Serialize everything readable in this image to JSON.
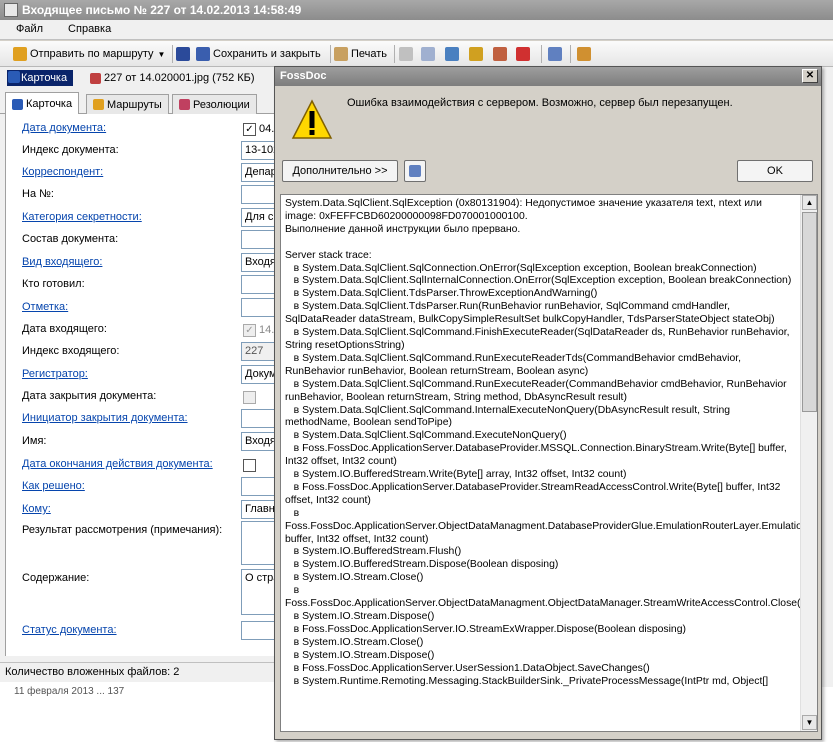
{
  "window": {
    "title": "Входящее письмо № 227 от 14.02.2013 14:58:49"
  },
  "menu": [
    "Файл",
    "Справка"
  ],
  "toolbar": {
    "route_label": "Отправить по маршруту",
    "save_close_label": "Сохранить и закрыть",
    "print_label": "Печать"
  },
  "attachments": {
    "tab_label": "Карточка",
    "file_label": "227 от 14.020001.jpg (752 КБ)"
  },
  "tabs": [
    "Карточка",
    "Маршруты",
    "Резолюции"
  ],
  "form_fields": [
    {
      "label": "Дата документа:",
      "link": true,
      "value": "04.",
      "type": "check"
    },
    {
      "label": "Индекс документа:",
      "link": false,
      "value": "13-102",
      "type": "text"
    },
    {
      "label": "Корреспондент:",
      "link": true,
      "value": "Депар",
      "type": "text"
    },
    {
      "label": "На №:",
      "link": false,
      "value": "",
      "type": "text"
    },
    {
      "label": "Категория секретности:",
      "link": true,
      "value": "Для с",
      "type": "text"
    },
    {
      "label": "Состав документа:",
      "link": false,
      "value": "",
      "type": "text"
    },
    {
      "label": "Вид входящего:",
      "link": true,
      "value": "Входя",
      "type": "text"
    },
    {
      "label": "Кто готовил:",
      "link": false,
      "value": "",
      "type": "text"
    },
    {
      "label": "Отметка:",
      "link": true,
      "value": "",
      "type": "text"
    },
    {
      "label": "Дата входящего:",
      "link": false,
      "value": "14.",
      "type": "checkdis"
    },
    {
      "label": "Индекс входящего:",
      "link": false,
      "value": "227",
      "type": "gray"
    },
    {
      "label": "Регистратор:",
      "link": true,
      "value": "Докум",
      "type": "text"
    },
    {
      "label": "Дата закрытия документа:",
      "link": false,
      "value": "",
      "type": "checkdis"
    },
    {
      "label": "Инициатор закрытия документа:",
      "link": true,
      "value": "",
      "type": "text"
    },
    {
      "label": "Имя:",
      "link": false,
      "value": "Входя",
      "type": "text"
    },
    {
      "label": "Дата окончания действия документа:",
      "link": true,
      "value": "",
      "type": "check"
    },
    {
      "label": "Как решено:",
      "link": true,
      "value": "",
      "type": "text"
    },
    {
      "label": "Кому:",
      "link": true,
      "value": "Главн",
      "type": "text"
    },
    {
      "label": "Результат рассмотрения (примечания):",
      "link": false,
      "value": "",
      "type": "area"
    },
    {
      "label": "Содержание:",
      "link": false,
      "value": "О стра",
      "type": "area"
    },
    {
      "label": "Статус документа:",
      "link": true,
      "value": "",
      "type": "text"
    }
  ],
  "status": {
    "attached_count_text": "Количество вложенных файлов: 2"
  },
  "list_row": {
    "text": "11 февраля 2013 ... 137"
  },
  "dialog": {
    "title": "FossDoc",
    "message": "Ошибка взаимодействия с сервером. Возможно, сервер был перезапущен.",
    "details_button": "Дополнительно >>",
    "ok_button": "OK",
    "error_text": "System.Data.SqlClient.SqlException (0x80131904): Недопустимое значение указателя text, ntext или image: 0xFEFFCBD60200000098FD070001000100.\nВыполнение данной инструкции было прервано.\n\nServer stack trace:\n   в System.Data.SqlClient.SqlConnection.OnError(SqlException exception, Boolean breakConnection)\n   в System.Data.SqlClient.SqlInternalConnection.OnError(SqlException exception, Boolean breakConnection)\n   в System.Data.SqlClient.TdsParser.ThrowExceptionAndWarning()\n   в System.Data.SqlClient.TdsParser.Run(RunBehavior runBehavior, SqlCommand cmdHandler, SqlDataReader dataStream, BulkCopySimpleResultSet bulkCopyHandler, TdsParserStateObject stateObj)\n   в System.Data.SqlClient.SqlCommand.FinishExecuteReader(SqlDataReader ds, RunBehavior runBehavior, String resetOptionsString)\n   в System.Data.SqlClient.SqlCommand.RunExecuteReaderTds(CommandBehavior cmdBehavior, RunBehavior runBehavior, Boolean returnStream, Boolean async)\n   в System.Data.SqlClient.SqlCommand.RunExecuteReader(CommandBehavior cmdBehavior, RunBehavior runBehavior, Boolean returnStream, String method, DbAsyncResult result)\n   в System.Data.SqlClient.SqlCommand.InternalExecuteNonQuery(DbAsyncResult result, String methodName, Boolean sendToPipe)\n   в System.Data.SqlClient.SqlCommand.ExecuteNonQuery()\n   в Foss.FossDoc.ApplicationServer.DatabaseProvider.MSSQL.Connection.BinaryStream.Write(Byte[] buffer, Int32 offset, Int32 count)\n   в System.IO.BufferedStream.Write(Byte[] array, Int32 offset, Int32 count)\n   в Foss.FossDoc.ApplicationServer.DatabaseProvider.StreamReadAccessControl.Write(Byte[] buffer, Int32 offset, Int32 count)\n   в\nFoss.FossDoc.ApplicationServer.ObjectDataManagment.DatabaseProviderGlue.EmulationRouterLayer.EmulationRouterLayer.DetachedStream.Write(Byte[] buffer, Int32 offset, Int32 count)\n   в System.IO.BufferedStream.Flush()\n   в System.IO.BufferedStream.Dispose(Boolean disposing)\n   в System.IO.Stream.Close()\n   в\nFoss.FossDoc.ApplicationServer.ObjectDataManagment.ObjectDataManager.StreamWriteAccessControl.Close()\n   в System.IO.Stream.Dispose()\n   в Foss.FossDoc.ApplicationServer.IO.StreamExWrapper.Dispose(Boolean disposing)\n   в System.IO.Stream.Close()\n   в System.IO.Stream.Dispose()\n   в Foss.FossDoc.ApplicationServer.UserSession1.DataObject.SaveChanges()\n   в System.Runtime.Remoting.Messaging.StackBuilderSink._PrivateProcessMessage(IntPtr md, Object[]"
  },
  "colors": {
    "dialog_title": "#8a8a8a",
    "link": "#0645ad",
    "selection": "#0a246a",
    "warning": "#ffd700"
  }
}
